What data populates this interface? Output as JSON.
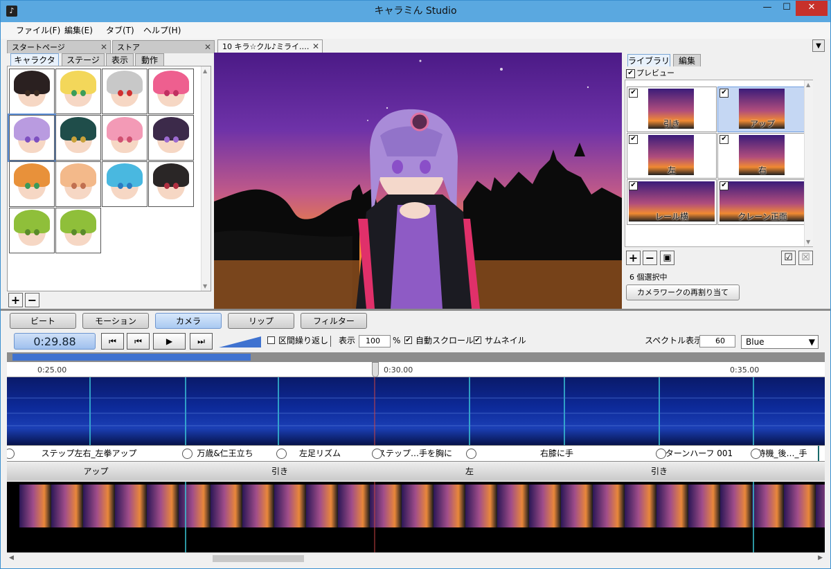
{
  "window": {
    "title": "キャラミん Studio",
    "minimize": "—",
    "maximize": "☐",
    "close": "✕"
  },
  "menu": [
    "ファイル(F)",
    "編集(E)",
    "タブ(T)",
    "ヘルプ(H)"
  ],
  "doc_tabs": {
    "start": "スタートページ",
    "store": "ストア",
    "project": "10 キラ☆クル♪ミライ.…",
    "dropdown": "▼"
  },
  "left_tabs": [
    "キャラクター",
    "ステージ",
    "表示",
    "動作"
  ],
  "right_tabs": [
    "ライブラリ",
    "編集"
  ],
  "preview_toggle": {
    "checked": "✔",
    "label": "プレビュー"
  },
  "characters": [
    {
      "hair": "#2a2020",
      "eye": "#3a2a20"
    },
    {
      "hair": "#f3d75a",
      "eye": "#3a9c5a"
    },
    {
      "hair": "#c8c8c8",
      "eye": "#d03030"
    },
    {
      "hair": "#ee5f8f",
      "eye": "#c03060"
    },
    {
      "hair": "#b99be0",
      "eye": "#7d4fc0"
    },
    {
      "hair": "#1f4d4a",
      "eye": "#c9a23a"
    },
    {
      "hair": "#f39ab6",
      "eye": "#d05070"
    },
    {
      "hair": "#3c2a4a",
      "eye": "#9c6ad0"
    },
    {
      "hair": "#e8913a",
      "eye": "#3a9a5a"
    },
    {
      "hair": "#f3b98a",
      "eye": "#c07050"
    },
    {
      "hair": "#49b8e0",
      "eye": "#2a7ac0"
    },
    {
      "hair": "#2a2626",
      "eye": "#b03040"
    },
    {
      "hair": "#8fbf3a",
      "eye": "#5a8a2a"
    },
    {
      "hair": "#8fbf3a",
      "eye": "#5a8a2a"
    }
  ],
  "library": [
    {
      "label": "引き",
      "checked": "✔",
      "selected": false,
      "wide": false
    },
    {
      "label": "アップ",
      "checked": "✔",
      "selected": true,
      "wide": false
    },
    {
      "label": "左",
      "checked": "✔",
      "selected": false,
      "wide": false
    },
    {
      "label": "右",
      "checked": "✔",
      "selected": false,
      "wide": false
    },
    {
      "label": "レール横",
      "checked": "✔",
      "selected": false,
      "wide": true
    },
    {
      "label": "クレーン正面",
      "checked": "✔",
      "selected": false,
      "wide": true
    }
  ],
  "library_buttons": {
    "add": "+",
    "remove": "−",
    "save": "▣",
    "check_all": "☑",
    "uncheck": "☒"
  },
  "selection_status": "6 個選択中",
  "reassign_button": "カメラワークの再割り当て",
  "char_buttons": {
    "add": "+",
    "remove": "−"
  },
  "mode_tabs": [
    "ビート",
    "モーション",
    "カメラ",
    "リップ",
    "フィルター"
  ],
  "transport": {
    "time": "0:29.88",
    "first": "⏮",
    "prev": "⏮",
    "play": "▶",
    "next": "⏭"
  },
  "options": {
    "loop_label": "区間繰り返し",
    "zoom_label": "表示",
    "zoom_value": "100",
    "zoom_unit": "%",
    "autoscroll_label": "自動スクロール",
    "autoscroll_check": "✔",
    "thumbnail_label": "サムネイル",
    "thumbnail_check": "✔",
    "spectrum_label": "スペクトル表示",
    "spectrum_value": "60",
    "color_value": "Blue",
    "color_arrow": "▼"
  },
  "timeline": {
    "ticks": [
      "0:25.00",
      "0:30.00",
      "0:35.00"
    ],
    "progress": 0.295,
    "motions": [
      {
        "label": "ステップ左右_左拳アップ",
        "w": 257
      },
      {
        "label": "万歳&仁王立ち",
        "w": 136
      },
      {
        "label": "左足リズム",
        "w": 138
      },
      {
        "label": "ステップ…手を胸に",
        "w": 136
      },
      {
        "label": "右膝に手",
        "w": 274
      },
      {
        "label": "ターンハーフ 001",
        "w": 137
      },
      {
        "label": "待機_後…_手",
        "w": 103
      }
    ],
    "cameras": [
      {
        "label": "アップ",
        "w": 257
      },
      {
        "label": "引き",
        "w": 274
      },
      {
        "label": "左",
        "w": 274
      },
      {
        "label": "引き",
        "w": 274
      },
      {
        "label": "",
        "w": 102
      }
    ]
  }
}
